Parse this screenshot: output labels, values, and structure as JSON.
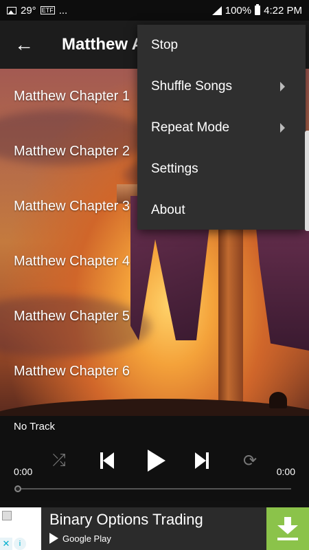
{
  "status_bar": {
    "temperature": "29°",
    "dots": "...",
    "battery": "100%",
    "time": "4:22 PM"
  },
  "app_bar": {
    "title": "Matthew Audio Bible",
    "back_icon": "arrow-back-icon"
  },
  "songs": [
    "Matthew Chapter 1",
    "Matthew Chapter 2",
    "Matthew Chapter 3",
    "Matthew Chapter 4",
    "Matthew Chapter 5",
    "Matthew Chapter 6"
  ],
  "player": {
    "track": "No Track",
    "time_elapsed": "0:00",
    "time_total": "0:00",
    "progress": 0
  },
  "menu": {
    "items": [
      {
        "label": "Stop",
        "submenu": false
      },
      {
        "label": "Shuffle Songs",
        "submenu": true
      },
      {
        "label": "Repeat Mode",
        "submenu": true
      },
      {
        "label": "Settings",
        "submenu": false
      },
      {
        "label": "About",
        "submenu": false
      }
    ]
  },
  "ad": {
    "title": "Binary Options Trading",
    "store": "Google Play",
    "cta_icon": "download-icon",
    "cta_color": "#8bc34a"
  }
}
